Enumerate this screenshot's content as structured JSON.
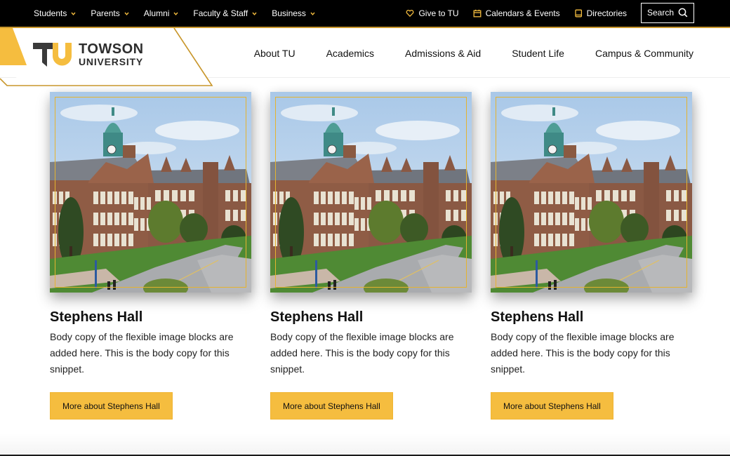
{
  "brand": {
    "name_line1": "TOWSON",
    "name_line2": "UNIVERSITY",
    "gold": "#f5bd3f",
    "gold_dark": "#c8962b",
    "black": "#000000"
  },
  "utility_bar": {
    "audience_links": [
      {
        "label": "Students",
        "icon": "chevron-down-icon"
      },
      {
        "label": "Parents",
        "icon": "chevron-down-icon"
      },
      {
        "label": "Alumni",
        "icon": "chevron-down-icon"
      },
      {
        "label": "Faculty & Staff",
        "icon": "chevron-down-icon"
      },
      {
        "label": "Business",
        "icon": "chevron-down-icon"
      }
    ],
    "quick_links": [
      {
        "label": "Give to TU",
        "icon": "heart-icon"
      },
      {
        "label": "Calendars & Events",
        "icon": "calendar-icon"
      },
      {
        "label": "Directories",
        "icon": "book-icon"
      }
    ],
    "search_label": "Search"
  },
  "main_nav": {
    "items": [
      {
        "label": "About TU"
      },
      {
        "label": "Academics"
      },
      {
        "label": "Admissions & Aid"
      },
      {
        "label": "Student Life"
      },
      {
        "label": "Campus & Community"
      }
    ]
  },
  "cards": [
    {
      "title": "Stephens Hall",
      "body": "Body copy of the flexible image blocks are added here. This is the body copy for this snippet.",
      "button_label": "More about Stephens Hall",
      "image_alt": "Stephens Hall building with clock tower"
    },
    {
      "title": "Stephens Hall",
      "body": "Body copy of the flexible image blocks are added here. This is the body copy for this snippet.",
      "button_label": "More about Stephens Hall",
      "image_alt": "Stephens Hall building with clock tower"
    },
    {
      "title": "Stephens Hall",
      "body": "Body copy of the flexible image blocks are added here. This is the body copy for this snippet.",
      "button_label": "More about Stephens Hall",
      "image_alt": "Stephens Hall building with clock tower"
    }
  ]
}
